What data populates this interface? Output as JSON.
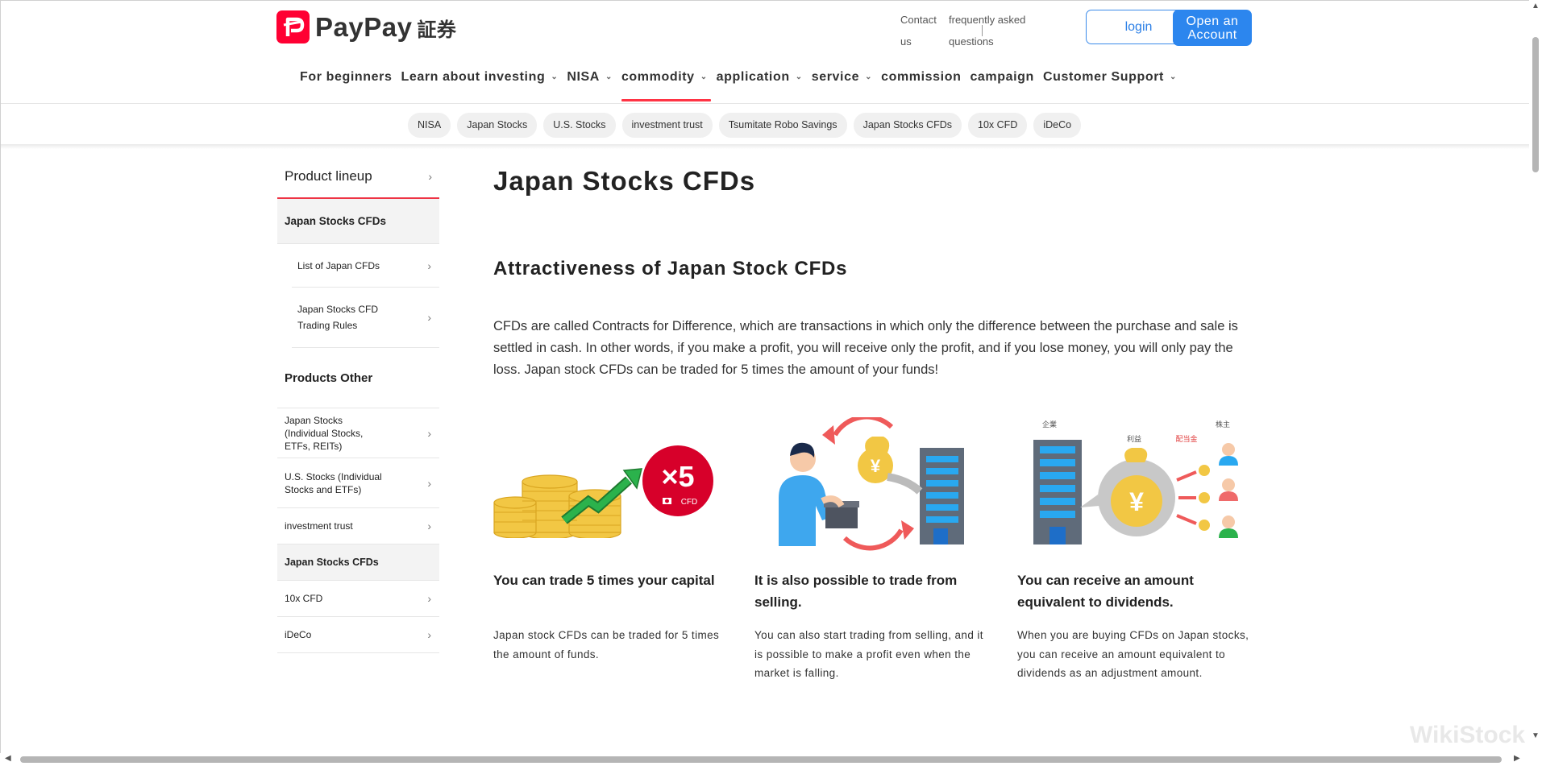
{
  "header": {
    "logo_text": "PayPay",
    "logo_kanji": "証券",
    "contact_label": "Contact us",
    "faq_label": "frequently asked questions",
    "login_label": "login",
    "open_account_label": "Open an Account"
  },
  "main_nav": [
    {
      "label": "For beginners",
      "has_menu": false,
      "active": false
    },
    {
      "label": "Learn about investing",
      "has_menu": true,
      "active": false
    },
    {
      "label": "NISA",
      "has_menu": true,
      "active": false
    },
    {
      "label": "commodity",
      "has_menu": true,
      "active": true
    },
    {
      "label": "application",
      "has_menu": true,
      "active": false
    },
    {
      "label": "service",
      "has_menu": true,
      "active": false
    },
    {
      "label": "commission",
      "has_menu": false,
      "active": false
    },
    {
      "label": "campaign",
      "has_menu": false,
      "active": false
    },
    {
      "label": "Customer Support",
      "has_menu": true,
      "active": false
    }
  ],
  "sub_nav": [
    "NISA",
    "Japan Stocks",
    "U.S. Stocks",
    "investment trust",
    "Tsumitate Robo Savings",
    "Japan Stocks CFDs",
    "10x CFD",
    "iDeCo"
  ],
  "sidebar": {
    "heading": "Product lineup",
    "current": "Japan Stocks CFDs",
    "current_children": [
      "List of Japan CFDs",
      "Japan Stocks CFD Trading Rules"
    ],
    "group_label": "Products Other",
    "other_items": [
      {
        "label": "Japan Stocks (Individual Stocks, ETFs, REITs)",
        "selected": false
      },
      {
        "label": "U.S. Stocks (Individual Stocks and ETFs)",
        "selected": false
      },
      {
        "label": "investment trust",
        "selected": false
      },
      {
        "label": "Japan Stocks CFDs",
        "selected": true
      },
      {
        "label": "10x CFD",
        "selected": false
      },
      {
        "label": "iDeCo",
        "selected": false
      }
    ]
  },
  "main": {
    "title": "Japan Stocks CFDs",
    "section_title": "Attractiveness of Japan Stock CFDs",
    "lead": "CFDs are called Contracts for Difference, which are transactions in which only the difference between the purchase and sale is settled in cash. In other words, if you make a profit, you will receive only the profit, and if you lose money, you will only pay the loss. Japan stock CFDs can be traded for 5 times the amount of your funds!",
    "features": [
      {
        "title": "You can trade 5 times your capital",
        "desc": "Japan stock CFDs can be traded for 5 times the amount of funds.",
        "badge_big": "×5",
        "badge_small": "CFD",
        "symbol": "¥"
      },
      {
        "title": "It is also possible to trade from selling.",
        "desc": "You can also start trading from selling, and it is possible to make a profit even when the market is falling.",
        "symbol": "¥"
      },
      {
        "title": "You can receive an amount equivalent to dividends.",
        "desc": "When you are buying CFDs on Japan stocks, you can receive an amount equivalent to dividends as an adjustment amount.",
        "label_company": "企業",
        "label_profit": "利益",
        "label_dividend": "配当金",
        "label_shareholder": "株主",
        "symbol": "¥"
      }
    ]
  },
  "watermark": "WikiStock",
  "colors": {
    "brand_red": "#ff0033",
    "accent_blue": "#2c86ee",
    "active_underline": "#ff3344",
    "coin_gold": "#f2c744",
    "arrow_green": "#2bb24c",
    "badge_red": "#d7002a"
  }
}
